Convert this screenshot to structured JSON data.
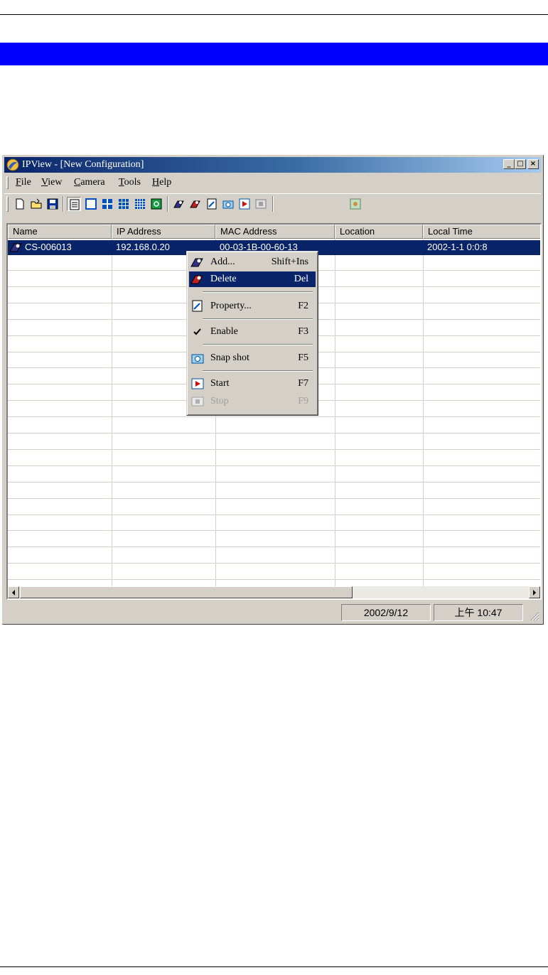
{
  "window": {
    "title": "IPView - [New Configuration]",
    "controls": [
      "_",
      "□",
      "×"
    ]
  },
  "menubar": {
    "items": [
      {
        "label": "File"
      },
      {
        "label": "View"
      },
      {
        "label": "Camera"
      },
      {
        "label": "Tools"
      },
      {
        "label": "Help"
      }
    ]
  },
  "toolbar": {
    "buttons": [
      "new-file-icon",
      "open-folder-icon",
      "save-disk-icon",
      "list-view-icon",
      "single-view-icon",
      "quad-view-icon",
      "nine-view-icon",
      "sixteen-view-icon",
      "cycle-view-icon",
      "add-camera-icon",
      "delete-camera-icon",
      "property-icon",
      "snapshot-icon",
      "start-icon",
      "stop-icon",
      "tools-icon"
    ]
  },
  "list": {
    "columns": [
      "Name",
      "IP Address",
      "MAC Address",
      "Location",
      "Local Time"
    ],
    "rows": [
      {
        "name": "CS-006013",
        "ip": "192.168.0.20",
        "mac": "00-03-1B-00-60-13",
        "location": "",
        "local_time": "2002-1-1  0:0:8"
      }
    ]
  },
  "context_menu": {
    "items": [
      {
        "label": "Add...",
        "shortcut": "Shift+Ins",
        "icon": "add-camera-icon"
      },
      {
        "label": "Delete",
        "shortcut": "Del",
        "icon": "delete-camera-icon",
        "highlighted": true
      },
      {
        "label": "Property...",
        "shortcut": "F2",
        "icon": "property-icon"
      },
      {
        "label": "Enable",
        "shortcut": "F3",
        "icon": "checkmark-icon",
        "checked": true
      },
      {
        "label": "Snap shot",
        "shortcut": "F5",
        "icon": "snapshot-icon"
      },
      {
        "label": "Start",
        "shortcut": "F7",
        "icon": "start-icon"
      },
      {
        "label": "Stop",
        "shortcut": "F9",
        "icon": "stop-icon",
        "disabled": true
      }
    ]
  },
  "statusbar": {
    "date": "2002/9/12",
    "time": "上午 10:47"
  },
  "colors": {
    "page_banner": "#0000ff",
    "selection": "#0a246a",
    "titlebar_start": "#0a246a",
    "titlebar_end": "#a6caf0"
  }
}
